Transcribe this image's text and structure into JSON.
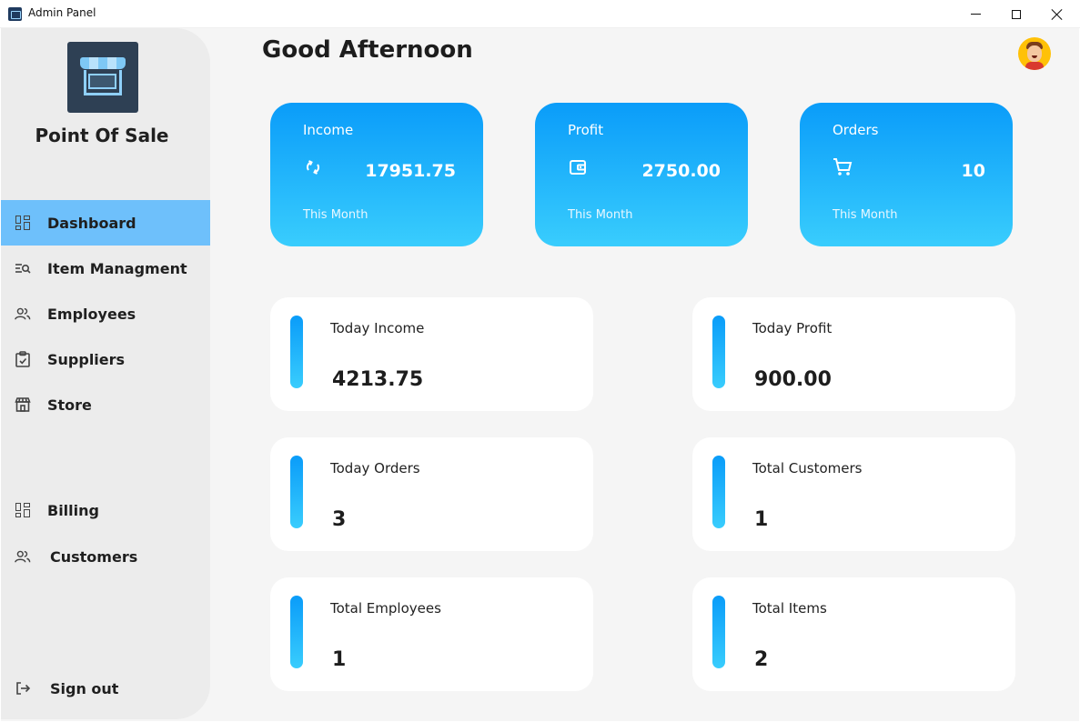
{
  "window": {
    "title": "Admin Panel"
  },
  "brand": {
    "name": "Point Of Sale"
  },
  "sidebar": {
    "items": [
      {
        "label": "Dashboard",
        "icon": "dashboard-icon",
        "active": true
      },
      {
        "label": "Item Managment",
        "icon": "item-search-icon",
        "active": false
      },
      {
        "label": "Employees",
        "icon": "people-icon",
        "active": false
      },
      {
        "label": "Suppliers",
        "icon": "clipboard-check-icon",
        "active": false
      },
      {
        "label": "Store",
        "icon": "store-icon",
        "active": false
      },
      {
        "label": "Billing",
        "icon": "dashboard-icon",
        "active": false
      },
      {
        "label": "Customers",
        "icon": "people-icon",
        "active": false
      }
    ],
    "signout": {
      "label": "Sign out",
      "icon": "logout-icon"
    }
  },
  "header": {
    "greeting": "Good Afternoon"
  },
  "stat_cards": [
    {
      "label": "Income",
      "value": "17951.75",
      "sub": "This Month",
      "icon": "refresh-icon"
    },
    {
      "label": "Profit",
      "value": "2750.00",
      "sub": "This Month",
      "icon": "wallet-icon"
    },
    {
      "label": "Orders",
      "value": "10",
      "sub": "This Month",
      "icon": "cart-icon"
    }
  ],
  "tiles": [
    {
      "label": "Today Income",
      "value": "4213.75"
    },
    {
      "label": "Today Profit",
      "value": "900.00"
    },
    {
      "label": "Today Orders",
      "value": "3"
    },
    {
      "label": "Total Customers",
      "value": "1"
    },
    {
      "label": "Total Employees",
      "value": "1"
    },
    {
      "label": "Total Items",
      "value": "2"
    }
  ],
  "colors": {
    "accent": "#0a9cf9",
    "accent_light": "#39cdfd",
    "active_nav": "#6ec0fb",
    "sidebar_bg": "#ececec",
    "page_bg": "#f5f5f5"
  }
}
